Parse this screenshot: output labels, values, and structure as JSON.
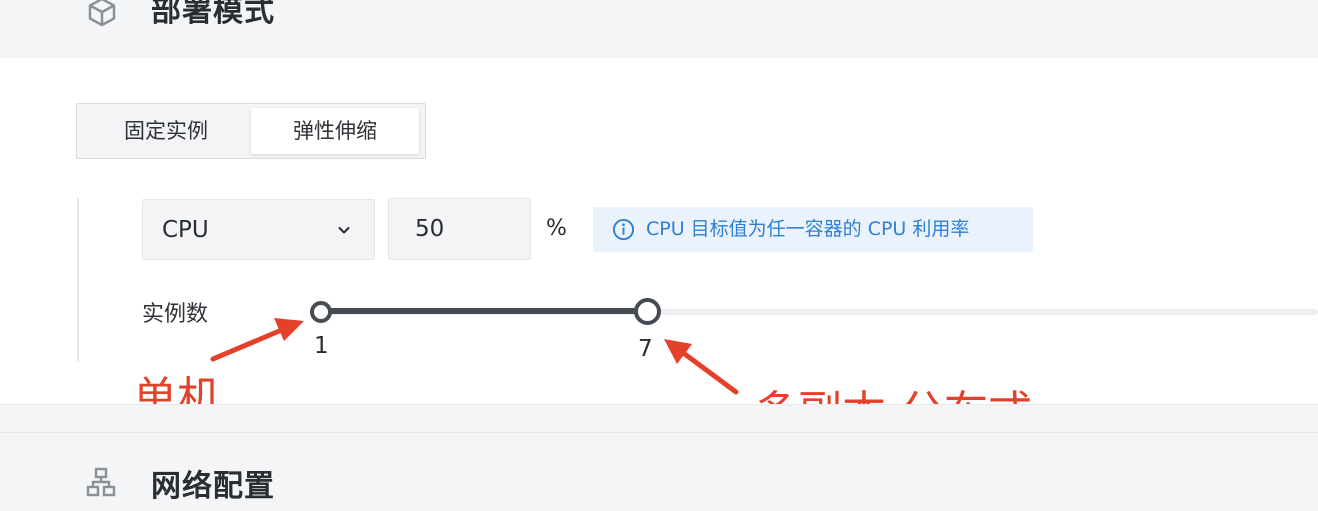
{
  "deploy_section": {
    "title": "部署模式",
    "icon": "cube-icon"
  },
  "mode_switch": {
    "options": [
      "固定实例",
      "弹性伸缩"
    ],
    "selected": "弹性伸缩"
  },
  "metric": {
    "selected": "CPU",
    "target_value": "50",
    "unit": "%",
    "hint": "CPU 目标值为任一容器的 CPU 利用率"
  },
  "instances": {
    "label": "实例数",
    "min": "1",
    "max": "7"
  },
  "annotations": {
    "single": "单机",
    "multi": "多副本 分布式"
  },
  "network_section": {
    "title": "网络配置",
    "icon": "network-icon"
  },
  "colors": {
    "annotation": "#e5402a",
    "hint_text": "#2f7fd4",
    "slider": "#474b52"
  }
}
